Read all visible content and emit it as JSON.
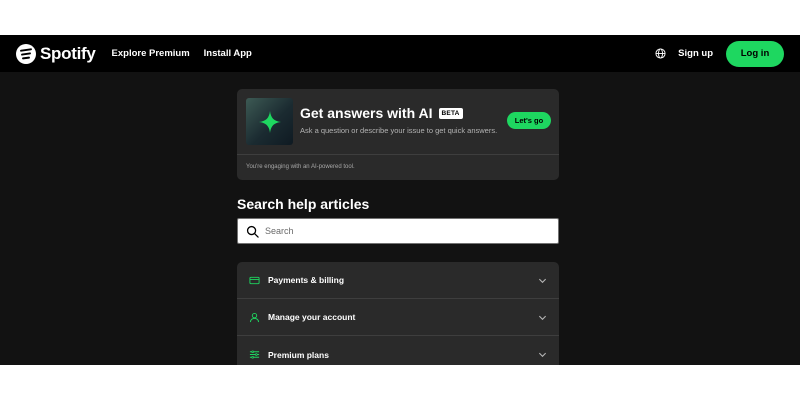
{
  "header": {
    "logo_text": "Spotify",
    "nav": [
      "Explore Premium",
      "Install App"
    ],
    "signup_label": "Sign up",
    "login_label": "Log in",
    "icons": [
      "spotify-logo",
      "globe-icon"
    ]
  },
  "ai_card": {
    "title": "Get answers with AI",
    "badge": "BETA",
    "subtitle": "Ask a question or describe your issue to get quick answers.",
    "cta_label": "Let's go",
    "note": "You're engaging with an AI-powered tool.",
    "icon": "sparkle-icon"
  },
  "search": {
    "title": "Search help articles",
    "placeholder": "Search",
    "value": ""
  },
  "topics": [
    {
      "label": "Payments & billing",
      "icon": "credit-card-icon"
    },
    {
      "label": "Manage your account",
      "icon": "user-icon"
    },
    {
      "label": "Premium plans",
      "icon": "list-icon"
    }
  ],
  "colors": {
    "accent": "#1ed760",
    "background": "#121212",
    "card": "#2a2a2a",
    "header": "#000000"
  }
}
